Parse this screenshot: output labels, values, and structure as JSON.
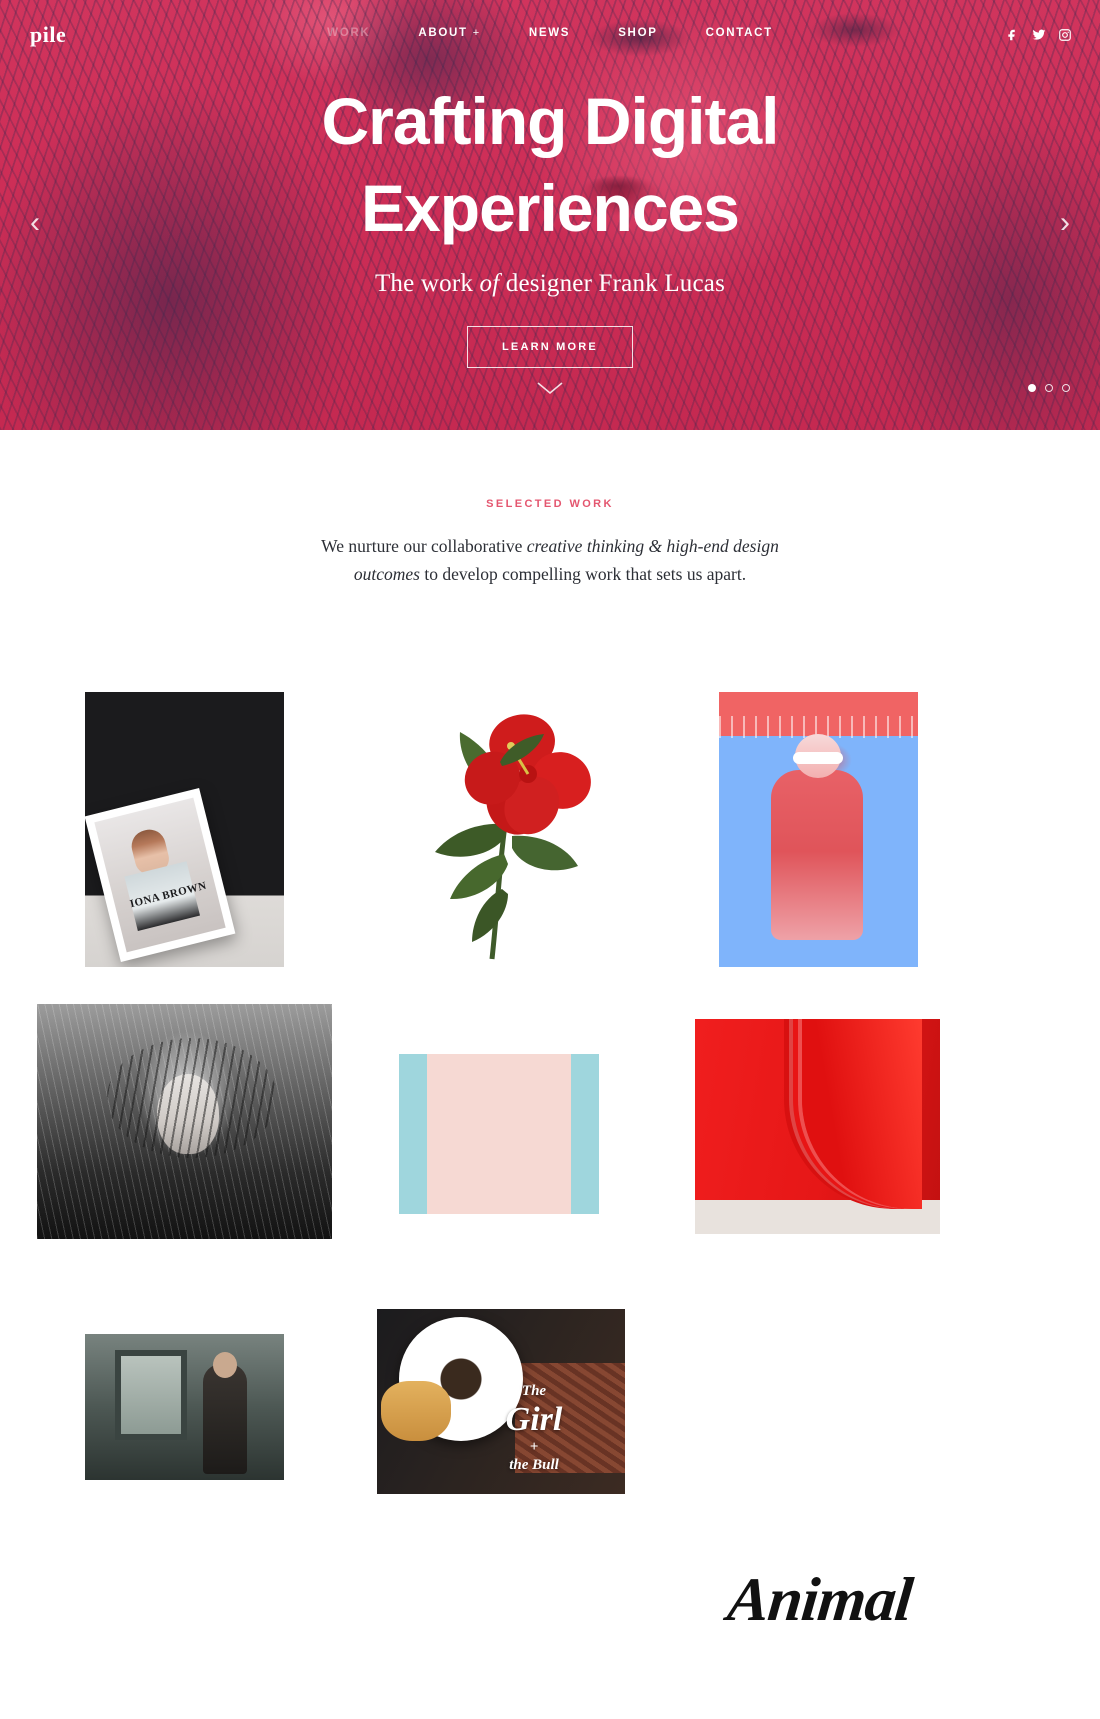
{
  "site": {
    "logo": "pile"
  },
  "nav": {
    "items": [
      {
        "label": "WORK",
        "dim": true,
        "caret": ""
      },
      {
        "label": "ABOUT",
        "dim": false,
        "caret": "+"
      },
      {
        "label": "NEWS",
        "dim": false,
        "caret": ""
      },
      {
        "label": "SHOP",
        "dim": false,
        "caret": ""
      },
      {
        "label": "CONTACT",
        "dim": false,
        "caret": ""
      }
    ],
    "socials": [
      {
        "name": "facebook-icon"
      },
      {
        "name": "twitter-icon"
      },
      {
        "name": "instagram-icon"
      }
    ]
  },
  "hero": {
    "title_line1": "Crafting Digital",
    "title_line2": "Experiences",
    "subtitle_before": "The work ",
    "subtitle_italic": "of",
    "subtitle_after": " designer Frank Lucas",
    "button_label": "LEARN MORE",
    "prev_arrow": "‹",
    "next_arrow": "›",
    "scroll_hint": "»",
    "slides": 3,
    "active_slide": 1,
    "bg_color": "#d2365f",
    "accent_color": "#e4566f"
  },
  "section": {
    "eyebrow": "SELECTED WORK",
    "lede_part1": "We nurture our collaborative ",
    "lede_italic1": "creative thinking & high-end design outcomes",
    "lede_part2": " to develop compelling work that sets us apart."
  },
  "portfolio": {
    "items": [
      {
        "name": "magazine-iona-brown",
        "caption": "IONA BROWN"
      },
      {
        "name": "red-hibiscus-flower",
        "caption": ""
      },
      {
        "name": "blue-pool-swimsuit",
        "caption": ""
      },
      {
        "name": "black-white-portrait",
        "caption": ""
      },
      {
        "name": "floral-dress",
        "caption": ""
      },
      {
        "name": "red-paper-curl",
        "caption": ""
      },
      {
        "name": "window-portrait",
        "caption": ""
      },
      {
        "name": "girl-and-the-bull-food",
        "caption_line1": "The",
        "caption_line2": "Girl",
        "caption_line3": "+",
        "caption_line4": "the Bull"
      }
    ]
  },
  "branding": {
    "animal_logo": "Animal"
  }
}
